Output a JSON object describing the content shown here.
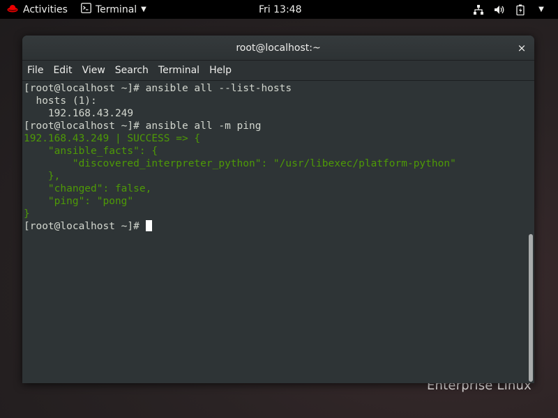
{
  "topbar": {
    "activities_label": "Activities",
    "app_label": "Terminal",
    "clock": "Fri 13:48",
    "tray_icons": [
      "network-icon",
      "volume-icon",
      "battery-icon",
      "power-menu-icon"
    ]
  },
  "window": {
    "title": "root@localhost:~",
    "close_glyph": "×",
    "menu": [
      "File",
      "Edit",
      "View",
      "Search",
      "Terminal",
      "Help"
    ]
  },
  "terminal": {
    "lines": [
      "[root@localhost ~]# ansible all --list-hosts",
      "  hosts (1):",
      "    192.168.43.249",
      "[root@localhost ~]# ansible all -m ping",
      "192.168.43.249 | SUCCESS => {",
      "    \"ansible_facts\": {",
      "        \"discovered_interpreter_python\": \"/usr/libexec/platform-python\"",
      "    },",
      "    \"changed\": false,",
      "    \"ping\": \"pong\"",
      "}",
      "[root@localhost ~]# "
    ],
    "colors": {
      "default": "#d3d7cf",
      "success": "#4e9a06"
    }
  },
  "wallpaper": {
    "brand_text": "Enterprise Linux"
  }
}
